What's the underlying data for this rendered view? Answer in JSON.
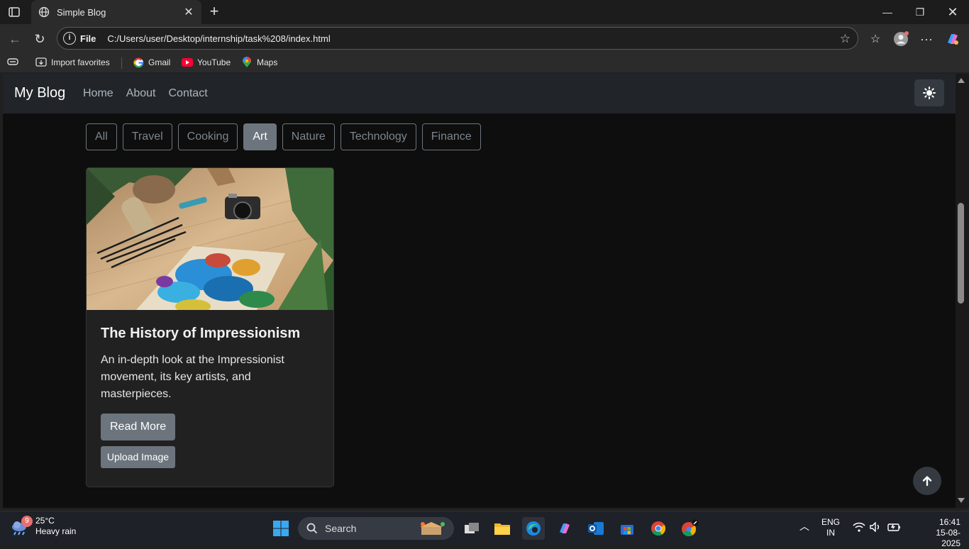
{
  "browser": {
    "tab_title": "Simple Blog",
    "url_scheme": "File",
    "url_path": "C:/Users/user/Desktop/internship/task%208/index.html",
    "favorites": [
      {
        "label": "Import favorites",
        "icon": "import-favorites-icon"
      },
      {
        "label": "Gmail",
        "icon": "google-icon"
      },
      {
        "label": "YouTube",
        "icon": "youtube-icon"
      },
      {
        "label": "Maps",
        "icon": "maps-pin-icon"
      }
    ]
  },
  "page": {
    "brand": "My Blog",
    "nav": [
      "Home",
      "About",
      "Contact"
    ],
    "filters": [
      "All",
      "Travel",
      "Cooking",
      "Art",
      "Nature",
      "Technology",
      "Finance"
    ],
    "active_filter": "Art",
    "card": {
      "title": "The History of Impressionism",
      "text": "An in-depth look at the Impressionist movement, its key artists, and masterpieces.",
      "read_more": "Read More",
      "upload": "Upload Image"
    }
  },
  "taskbar": {
    "weather_badge": "9",
    "temperature": "25°C",
    "condition": "Heavy rain",
    "search_label": "Search",
    "lang_top": "ENG",
    "lang_bottom": "IN",
    "time": "16:41",
    "date": "15-08-2025"
  },
  "colors": {
    "navbar": "#212529",
    "secondary": "#6c757d",
    "page_bg": "#0e0e0e",
    "card_bg": "#212121"
  }
}
